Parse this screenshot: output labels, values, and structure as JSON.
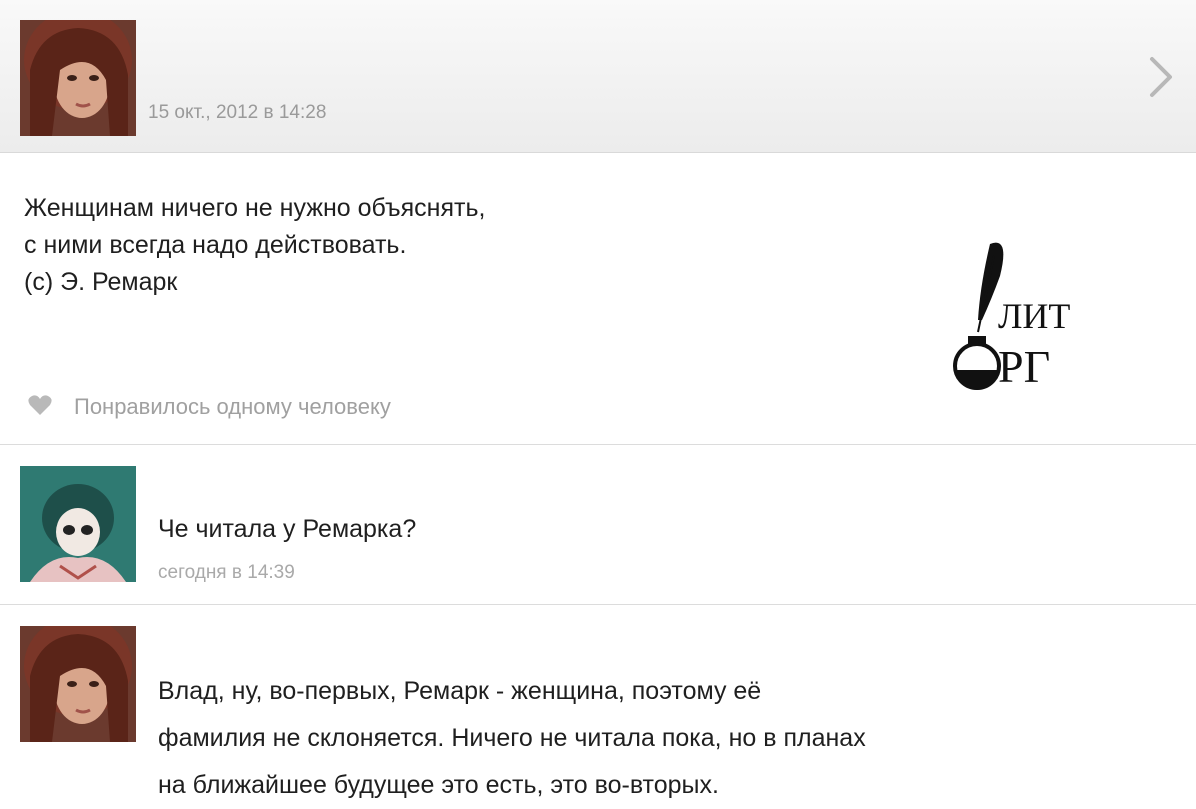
{
  "post": {
    "date": "15 окт., 2012 в 14:28",
    "lines": [
      "Женщинам ничего не нужно объяснять,",
      "с ними всегда надо действовать.",
      "(с) Э. Ремарк"
    ],
    "likes_text": "Понравилось одному человеку"
  },
  "logo": {
    "top": "ЛИТ",
    "bottom": "РГ"
  },
  "comments": [
    {
      "text": "Че читала у Ремарка?",
      "time": "сегодня в 14:39"
    },
    {
      "lines": [
        "Влад, ну, во-первых, Ремарк - женщина, поэтому её",
        "фамилия не склоняется. Ничего не читала пока, но в планах",
        "на ближайшее будущее это есть, это во-вторых."
      ]
    }
  ],
  "icons": {
    "chevron": "chevron-right-icon",
    "heart": "heart-icon"
  },
  "colors": {
    "header_bg": "#ececec",
    "muted_text": "#9a9a9a",
    "body_text": "#1f1f1f"
  }
}
